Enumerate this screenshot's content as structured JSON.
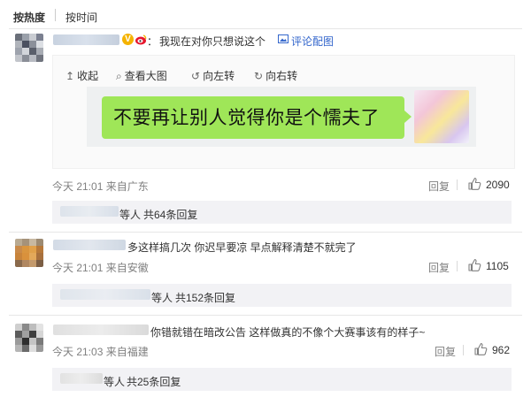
{
  "sort_tabs": {
    "hot": "按热度",
    "time": "按时间"
  },
  "comments": [
    {
      "badge": "V",
      "colon": "：",
      "text": "我现在对你只想说这个",
      "image_comment_label": "评论配图",
      "image_tools": {
        "collapse": "收起",
        "view_large": "查看大图",
        "rotate_left": "向左转",
        "rotate_right": "向右转"
      },
      "image_text": "不要再让别人觉得你是个懦夫了",
      "time": "今天 21:01 来自广东",
      "reply_label": "回复",
      "likes": "2090",
      "replies": {
        "suffix": "等人",
        "count_text": "共64条回复"
      }
    },
    {
      "text": "多这样搞几次 你迟早要凉 早点解释清楚不就完了",
      "time": "今天 21:01 来自安徽",
      "reply_label": "回复",
      "likes": "1105",
      "replies": {
        "suffix": "等人",
        "count_text": "共152条回复"
      }
    },
    {
      "text": "你错就错在暗改公告 这样做真的不像个大赛事该有的样子~",
      "time": "今天 21:03 来自福建",
      "reply_label": "回复",
      "likes": "962",
      "replies": {
        "suffix": "等人",
        "count_text": "共25条回复"
      }
    }
  ],
  "colors": {
    "link": "#eb7350",
    "blue_link": "#3366cc",
    "bubble_green": "#9fe658",
    "meta_gray": "#808080"
  },
  "icons": {
    "collapse": "arrow-up-icon",
    "view_large": "magnifier-icon",
    "rotate_left": "rotate-left-icon",
    "rotate_right": "rotate-right-icon",
    "like": "thumbs-up-icon",
    "image": "image-icon",
    "badge": "verified-v-icon"
  }
}
